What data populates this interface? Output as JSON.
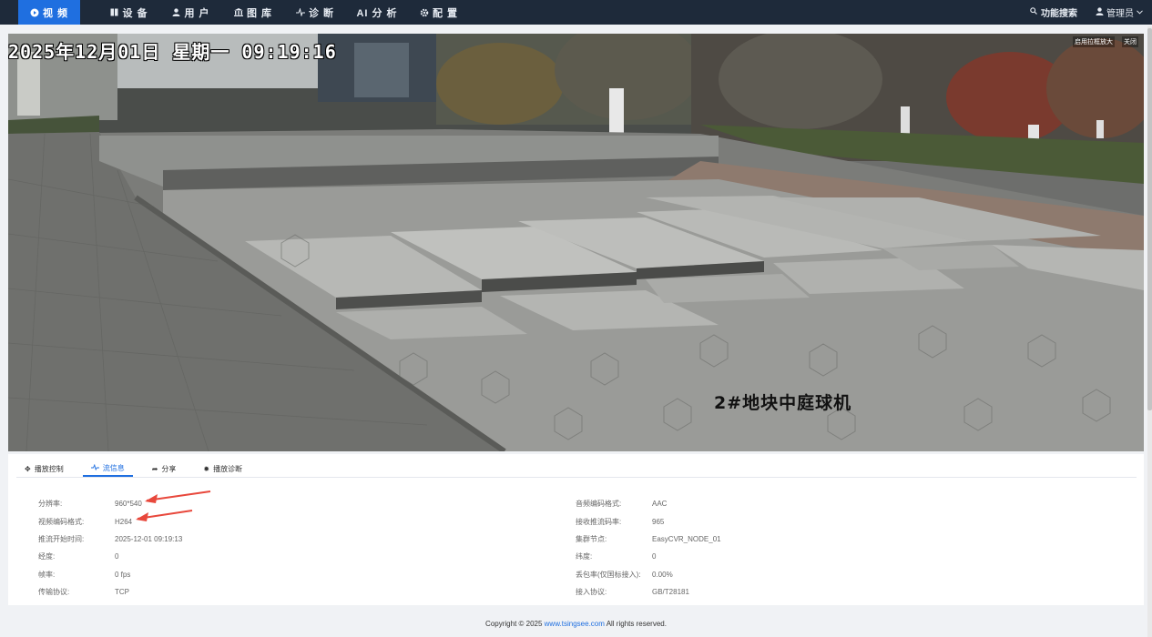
{
  "nav": {
    "items": [
      {
        "label": "视 频",
        "icon": "play-circle-icon",
        "active": true
      },
      {
        "label": "设 备",
        "icon": "device-icon",
        "active": false
      },
      {
        "label": "用 户",
        "icon": "user-icon",
        "active": false
      },
      {
        "label": "图 库",
        "icon": "gallery-icon",
        "active": false
      },
      {
        "label": "诊 断",
        "icon": "pulse-icon",
        "active": false
      },
      {
        "label": "AI 分 析",
        "icon": "",
        "active": false
      },
      {
        "label": "配 置",
        "icon": "gear-icon",
        "active": false
      }
    ],
    "search_label": "功能搜索",
    "user_label": "管理员"
  },
  "video": {
    "osd_time": "2025年12月01日 星期一 09:19:16",
    "osd_camera": "2#地块中庭球机",
    "ctrl_zoom": "启用拉框放大",
    "ctrl_close": "关闭"
  },
  "tabs": [
    {
      "label": "播放控制",
      "icon": "control-icon",
      "active": false
    },
    {
      "label": "流信息",
      "icon": "pulse-icon",
      "active": true
    },
    {
      "label": "分享",
      "icon": "share-icon",
      "active": false
    },
    {
      "label": "播放诊断",
      "icon": "diagnose-icon",
      "active": false
    }
  ],
  "info_left": [
    {
      "label": "分辨率:",
      "value": "960*540"
    },
    {
      "label": "视频编码格式:",
      "value": "H264"
    },
    {
      "label": "推流开始时间:",
      "value": "2025-12-01 09:19:13"
    },
    {
      "label": "经度:",
      "value": "0"
    },
    {
      "label": "帧率:",
      "value": "0 fps"
    },
    {
      "label": "传输协议:",
      "value": "TCP"
    }
  ],
  "info_right": [
    {
      "label": "音频编码格式:",
      "value": "AAC"
    },
    {
      "label": "接收推流码率:",
      "value": "965"
    },
    {
      "label": "集群节点:",
      "value": "EasyCVR_NODE_01"
    },
    {
      "label": "纬度:",
      "value": "0"
    },
    {
      "label": "丢包率(仅国标接入):",
      "value": "0.00%"
    },
    {
      "label": "接入协议:",
      "value": "GB/T28181"
    }
  ],
  "footer": {
    "prefix": "Copyright © 2025 ",
    "link": "www.tsingsee.com",
    "suffix": " All rights reserved."
  },
  "colors": {
    "nav_bg": "#1e2a3a",
    "accent": "#1f6fe0",
    "arrow": "#e8483c"
  }
}
